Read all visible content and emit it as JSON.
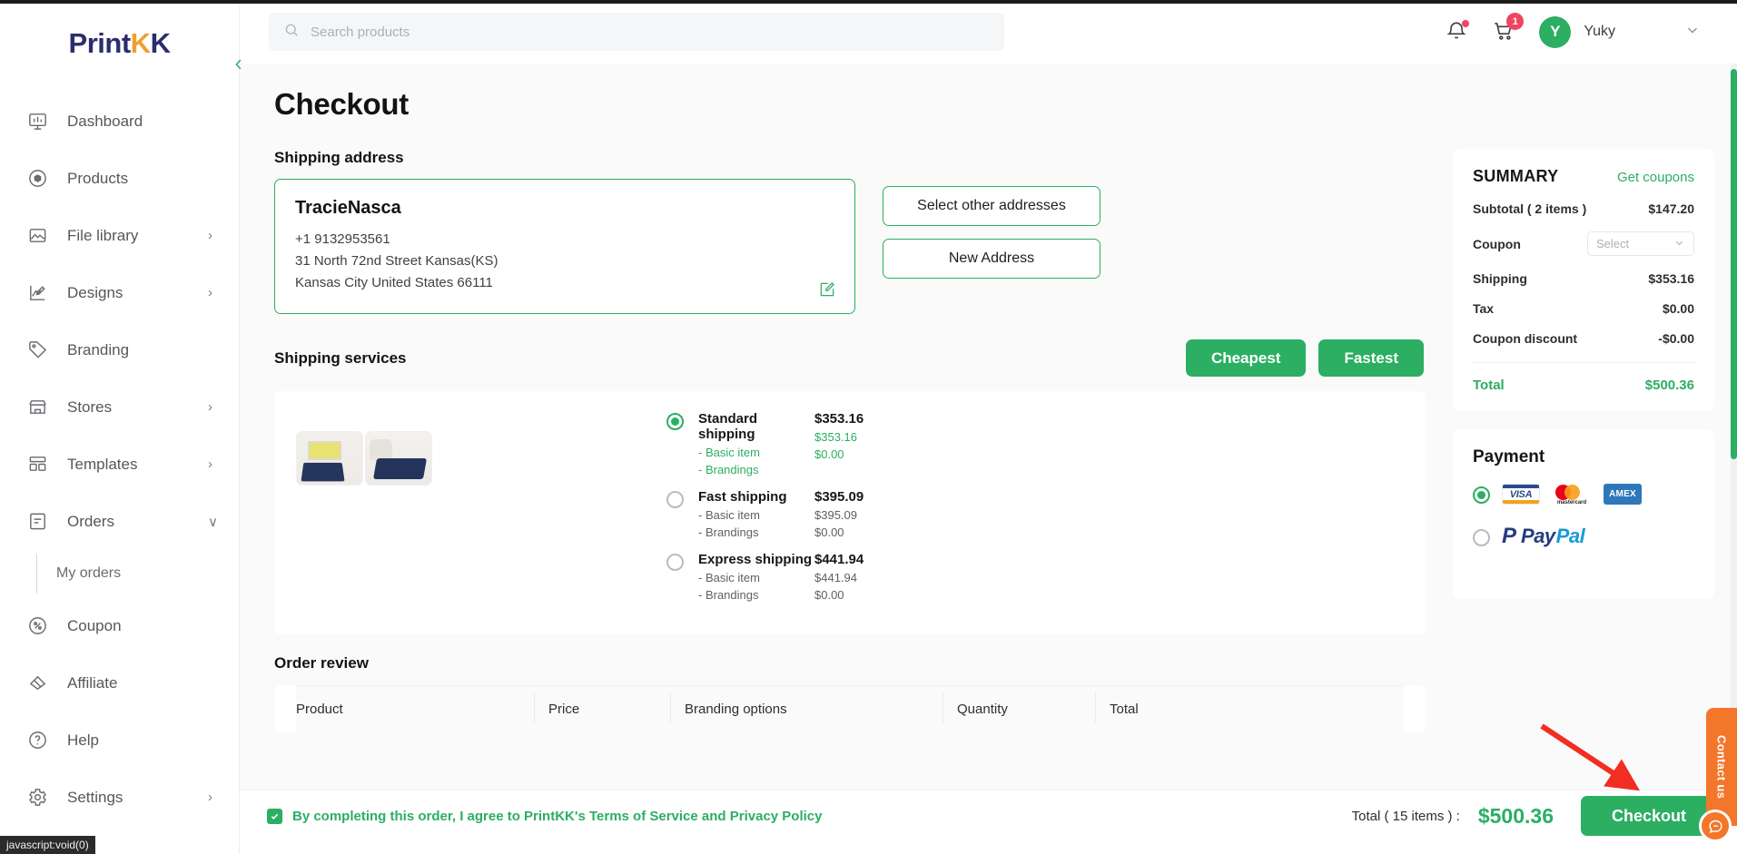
{
  "brand": {
    "name_part1": "Print",
    "name_k1": "K",
    "name_k2": "K",
    "accent_green": "#2cae63",
    "orange": "#f4762a"
  },
  "sidebar": {
    "items": [
      {
        "label": "Dashboard",
        "icon": "dashboard-icon",
        "chevron": ""
      },
      {
        "label": "Products",
        "icon": "products-icon",
        "chevron": ""
      },
      {
        "label": "File library",
        "icon": "file-library-icon",
        "chevron": "›"
      },
      {
        "label": "Designs",
        "icon": "designs-icon",
        "chevron": "›"
      },
      {
        "label": "Branding",
        "icon": "branding-icon",
        "chevron": ""
      },
      {
        "label": "Stores",
        "icon": "stores-icon",
        "chevron": "›"
      },
      {
        "label": "Templates",
        "icon": "templates-icon",
        "chevron": "›"
      },
      {
        "label": "Orders",
        "icon": "orders-icon",
        "chevron": "∨"
      }
    ],
    "sub_item": "My orders",
    "items_after": [
      {
        "label": "Coupon",
        "icon": "coupon-icon",
        "chevron": ""
      },
      {
        "label": "Affiliate",
        "icon": "affiliate-icon",
        "chevron": ""
      },
      {
        "label": "Help",
        "icon": "help-icon",
        "chevron": ""
      },
      {
        "label": "Settings",
        "icon": "settings-icon",
        "chevron": "›"
      }
    ]
  },
  "topbar": {
    "search_placeholder": "Search products",
    "search_value": "",
    "cart_count": "1",
    "avatar_initial": "Y",
    "username": "Yuky",
    "user_chevron": "∨"
  },
  "page": {
    "title": "Checkout"
  },
  "shipping_address": {
    "section_label": "Shipping address",
    "name": "TracieNasca",
    "phone": "+1  9132953561",
    "street": "31 North 72nd Street    Kansas(KS)",
    "city_line": "Kansas City  United States  66111",
    "select_other_btn": "Select other addresses",
    "new_address_btn": "New Address"
  },
  "shipping_services": {
    "section_label": "Shipping services",
    "cheapest_btn": "Cheapest",
    "fastest_btn": "Fastest",
    "options": [
      {
        "name": "Standard shipping",
        "price": "$353.16",
        "selected": true,
        "lines": [
          {
            "label": "- Basic item",
            "value": "$353.16"
          },
          {
            "label": "- Brandings",
            "value": "$0.00"
          }
        ]
      },
      {
        "name": "Fast shipping",
        "price": "$395.09",
        "selected": false,
        "lines": [
          {
            "label": "- Basic item",
            "value": "$395.09"
          },
          {
            "label": "- Brandings",
            "value": "$0.00"
          }
        ]
      },
      {
        "name": "Express shipping",
        "price": "$441.94",
        "selected": false,
        "lines": [
          {
            "label": "- Basic item",
            "value": "$441.94"
          },
          {
            "label": "- Brandings",
            "value": "$0.00"
          }
        ]
      }
    ]
  },
  "order_review": {
    "section_label": "Order review",
    "columns": [
      "Product",
      "Price",
      "Branding options",
      "Quantity",
      "Total"
    ]
  },
  "summary": {
    "title": "SUMMARY",
    "get_coupons": "Get coupons",
    "subtotal_label": "Subtotal ( 2 items )",
    "subtotal_value": "$147.20",
    "coupon_label": "Coupon",
    "coupon_select_placeholder": "Select",
    "shipping_label": "Shipping",
    "shipping_value": "$353.16",
    "tax_label": "Tax",
    "tax_value": "$0.00",
    "discount_label": "Coupon discount",
    "discount_value": "-$0.00",
    "total_label": "Total",
    "total_value": "$500.36"
  },
  "payment": {
    "title": "Payment",
    "card_option_selected": true,
    "cards": [
      "VISA",
      "mastercard",
      "AMEX"
    ],
    "paypal_label_1": "Pay",
    "paypal_label_2": "Pal",
    "paypal_selected": false
  },
  "bottombar": {
    "agree_text": "By completing this order, I agree to PrintKK's Terms of Service and Privacy Policy",
    "agree_checked": true,
    "total_label": "Total  ( 15 items )  :",
    "total_value": "$500.36",
    "checkout_btn": "Checkout"
  },
  "contact": {
    "label": "Contact us"
  },
  "statusbar": {
    "text": "javascript:void(0)"
  }
}
